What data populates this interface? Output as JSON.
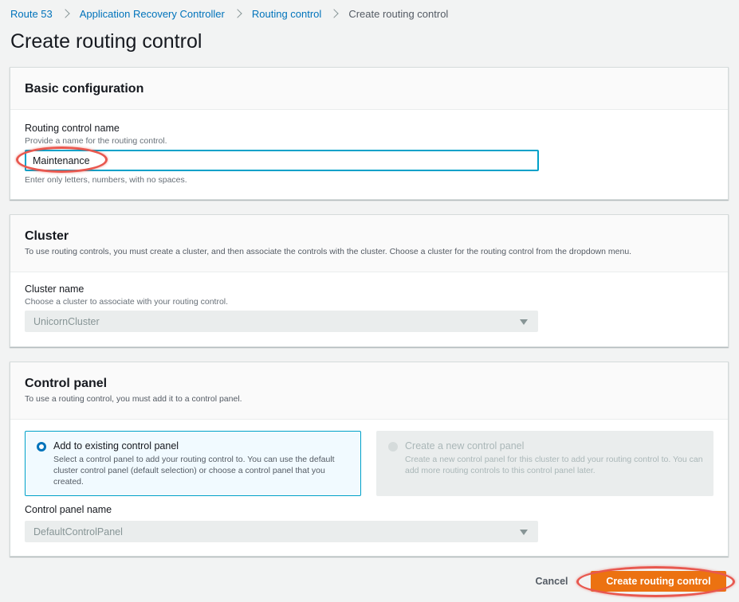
{
  "breadcrumb": {
    "items": [
      "Route 53",
      "Application Recovery Controller",
      "Routing control"
    ],
    "current": "Create routing control"
  },
  "page_title": "Create routing control",
  "basic_config": {
    "title": "Basic configuration",
    "name_label": "Routing control name",
    "name_hint": "Provide a name for the routing control.",
    "name_value": "Maintenance",
    "name_constraint": "Enter only letters, numbers, with no spaces."
  },
  "cluster": {
    "title": "Cluster",
    "description": "To use routing controls, you must create a cluster, and then associate the controls with the cluster. Choose a cluster for the routing control from the dropdown menu.",
    "name_label": "Cluster name",
    "name_hint": "Choose a cluster to associate with your routing control.",
    "selected": "UnicornCluster"
  },
  "control_panel": {
    "title": "Control panel",
    "description": "To use a routing control, you must add it to a control panel.",
    "options": [
      {
        "title": "Add to existing control panel",
        "description": "Select a control panel to add your routing control to. You can use the default cluster control panel (default selection) or choose a control panel that you created."
      },
      {
        "title": "Create a new control panel",
        "description": "Create a new control panel for this cluster to add your routing control to. You can add more routing controls to this control panel later."
      }
    ],
    "name_label": "Control panel name",
    "selected": "DefaultControlPanel"
  },
  "actions": {
    "cancel": "Cancel",
    "submit": "Create routing control"
  },
  "colors": {
    "accent": "#0073bb",
    "primary_button": "#ec7211",
    "focus_border": "#00a1c9",
    "highlight_annotation": "#e8584f"
  }
}
